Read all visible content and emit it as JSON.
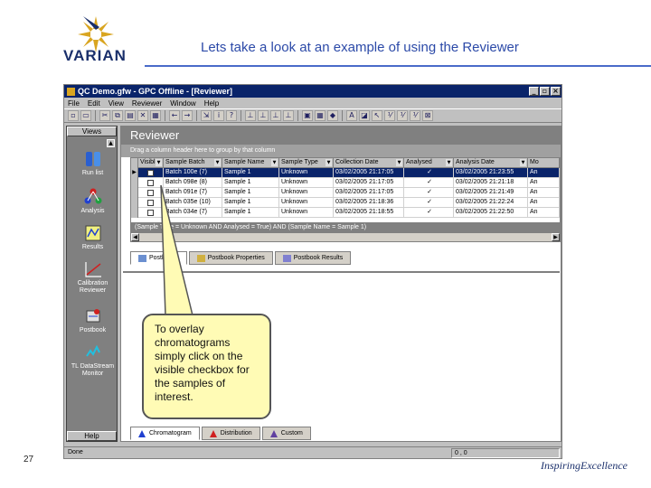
{
  "slide": {
    "logo_text": "VARIAN",
    "title": "Lets take a look at an example of using the Reviewer",
    "page_number": "27",
    "tagline_a": "Inspiring",
    "tagline_b": "Excellence"
  },
  "window": {
    "title": "QC Demo.gfw - GPC Offline - [Reviewer]",
    "controls": {
      "minimize": "_",
      "restore": "▫",
      "close": "×"
    },
    "menu": [
      "File",
      "Edit",
      "View",
      "Reviewer",
      "Window",
      "Help"
    ]
  },
  "sidebar": {
    "header": "Views",
    "items": [
      {
        "label": "Run list"
      },
      {
        "label": "Analysis"
      },
      {
        "label": "Results"
      },
      {
        "label": "Calibration Reviewer"
      },
      {
        "label": "Postbook"
      },
      {
        "label": "TL DataStream Monitor"
      }
    ],
    "footer": "Help"
  },
  "reviewer": {
    "title": "Reviewer",
    "group_hint": "Drag a column header here to group by that column",
    "columns": [
      "Visible",
      "Sample Batch",
      "Sample Name",
      "Sample Type",
      "Collection Date",
      "Analysed",
      "Analysis Date",
      "Mo"
    ],
    "rows": [
      {
        "batch": "Batch 100e (7)",
        "name": "Sample 1",
        "type": "Unknown",
        "collection": "03/02/2005 21:17:05",
        "analysed": "✓",
        "analysis": "03/02/2005 21:23:55",
        "mo": "An"
      },
      {
        "batch": "Batch 098e (8)",
        "name": "Sample 1",
        "type": "Unknown",
        "collection": "03/02/2005 21:17:05",
        "analysed": "✓",
        "analysis": "03/02/2005 21:21:18",
        "mo": "An"
      },
      {
        "batch": "Batch 091e (7)",
        "name": "Sample 1",
        "type": "Unknown",
        "collection": "03/02/2005 21:17:05",
        "analysed": "✓",
        "analysis": "03/02/2005 21:21:49",
        "mo": "An"
      },
      {
        "batch": "Batch 035e (10)",
        "name": "Sample 1",
        "type": "Unknown",
        "collection": "03/02/2005 21:18:36",
        "analysed": "✓",
        "analysis": "03/02/2005 21:22:24",
        "mo": "An"
      },
      {
        "batch": "Batch 034e (7)",
        "name": "Sample 1",
        "type": "Unknown",
        "collection": "03/02/2005 21:18:55",
        "analysed": "✓",
        "analysis": "03/02/2005 21:22:50",
        "mo": "An"
      }
    ],
    "filter": "(Sample Type = Unknown AND Analysed = True) AND (Sample Name = Sample 1)",
    "tabs_top": [
      "Postbooks",
      "Postbook Properties",
      "Postbook Results"
    ],
    "tabs_bottom": [
      "Chromatogram",
      "Distribution",
      "Custom"
    ]
  },
  "status": {
    "left": "Done",
    "right": "0 , 0"
  },
  "callout": "To overlay chromatograms simply click on the visible checkbox for the samples of interest.",
  "colors": {
    "title_bar": "#0a246a",
    "accent": "#2c4aa8",
    "callout_bg": "#fffbb5"
  }
}
